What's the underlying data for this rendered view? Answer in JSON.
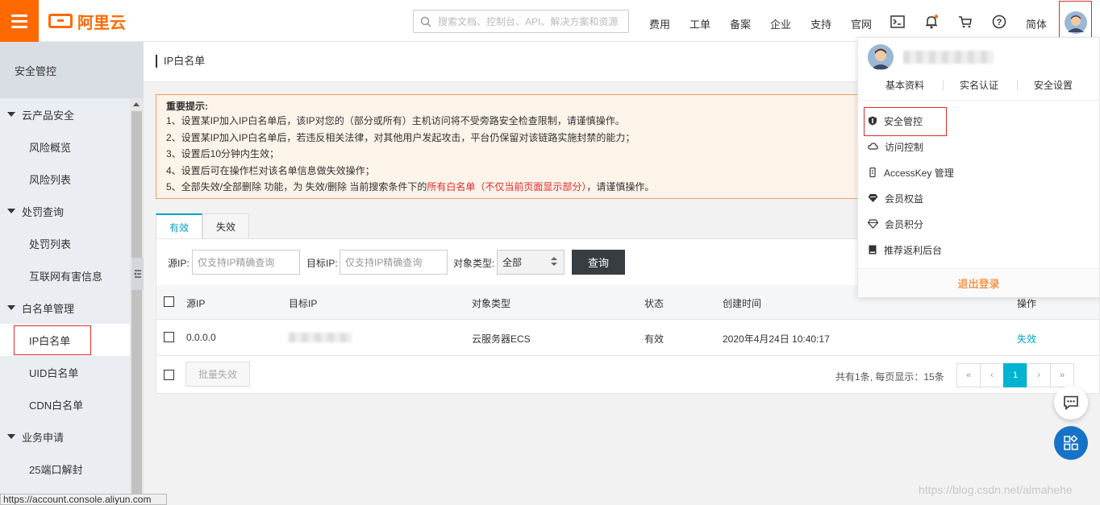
{
  "topbar": {
    "logo_text": "阿里云",
    "search_placeholder": "搜索文档、控制台、API、解决方案和资源",
    "nav": [
      "费用",
      "工单",
      "备案",
      "企业",
      "支持",
      "官网"
    ],
    "lang": "简体"
  },
  "sidebar": {
    "header": "安全管控",
    "groups": [
      {
        "label": "云产品安全",
        "items": [
          "风险概览",
          "风险列表"
        ]
      },
      {
        "label": "处罚查询",
        "items": [
          "处罚列表",
          "互联网有害信息"
        ]
      },
      {
        "label": "白名单管理",
        "items": [
          "IP白名单",
          "UID白名单",
          "CDN白名单"
        ]
      },
      {
        "label": "业务申请",
        "items": [
          "25端口解封"
        ]
      }
    ],
    "active_item": "IP白名单"
  },
  "main": {
    "title": "IP白名单",
    "notice": {
      "title": "重要提示:",
      "lines": [
        "1、设置某IP加入IP白名单后，该IP对您的（部分或所有）主机访问将不受旁路安全检查限制，请谨慎操作。",
        "2、设置某IP加入IP白名单后，若违反相关法律，对其他用户发起攻击，平台仍保留对该链路实施封禁的能力；",
        "3、设置后10分钟内生效；",
        "4、设置后可在操作栏对该名单信息做失效操作；"
      ],
      "line5_prefix": "5、全部失效/全部删除 功能，为 失效/删除 当前搜索条件下的",
      "line5_red": "所有白名单（不仅当前页面显示部分）",
      "line5_suffix": "，请谨慎操作。"
    },
    "tabs": [
      "有效",
      "失效"
    ],
    "filters": {
      "source_label": "源IP:",
      "source_placeholder": "仅支持IP精确查询",
      "target_label": "目标IP:",
      "target_placeholder": "仅支持IP精确查询",
      "type_label": "对象类型:",
      "type_value": "全部",
      "query_button": "查询"
    },
    "table": {
      "columns": [
        "源IP",
        "目标IP",
        "对象类型",
        "状态",
        "创建时间",
        "操作"
      ],
      "rows": [
        {
          "source_ip": "0.0.0.0",
          "object_type": "云服务器ECS",
          "status": "有效",
          "created": "2020年4月24日 10:40:17",
          "action": "失效"
        }
      ]
    },
    "footer": {
      "batch_button": "批量失效",
      "page_info": "共有1条, 每页显示：15条",
      "pager": [
        "«",
        "‹",
        "1",
        "›",
        "»"
      ]
    }
  },
  "dropdown": {
    "links": [
      "基本资料",
      "实名认证",
      "安全设置"
    ],
    "items": [
      {
        "label": "安全管控",
        "icon": "shield-icon"
      },
      {
        "label": "访问控制",
        "icon": "cloud-icon"
      },
      {
        "label": "AccessKey 管理",
        "icon": "key-icon"
      },
      {
        "label": "会员权益",
        "icon": "diamond-icon"
      },
      {
        "label": "会员积分",
        "icon": "diamond-outline-icon"
      },
      {
        "label": "推荐返利后台",
        "icon": "book-icon"
      }
    ],
    "logout": "退出登录"
  },
  "statusbar": {
    "url": "https://account.console.aliyun.com"
  },
  "watermark": "https://blog.csdn.net/almahehe",
  "colors": {
    "brand": "#ff6a00",
    "accent": "#00a2ca",
    "highlight_red": "#e02b2b",
    "fab_blue": "#1773c7"
  }
}
